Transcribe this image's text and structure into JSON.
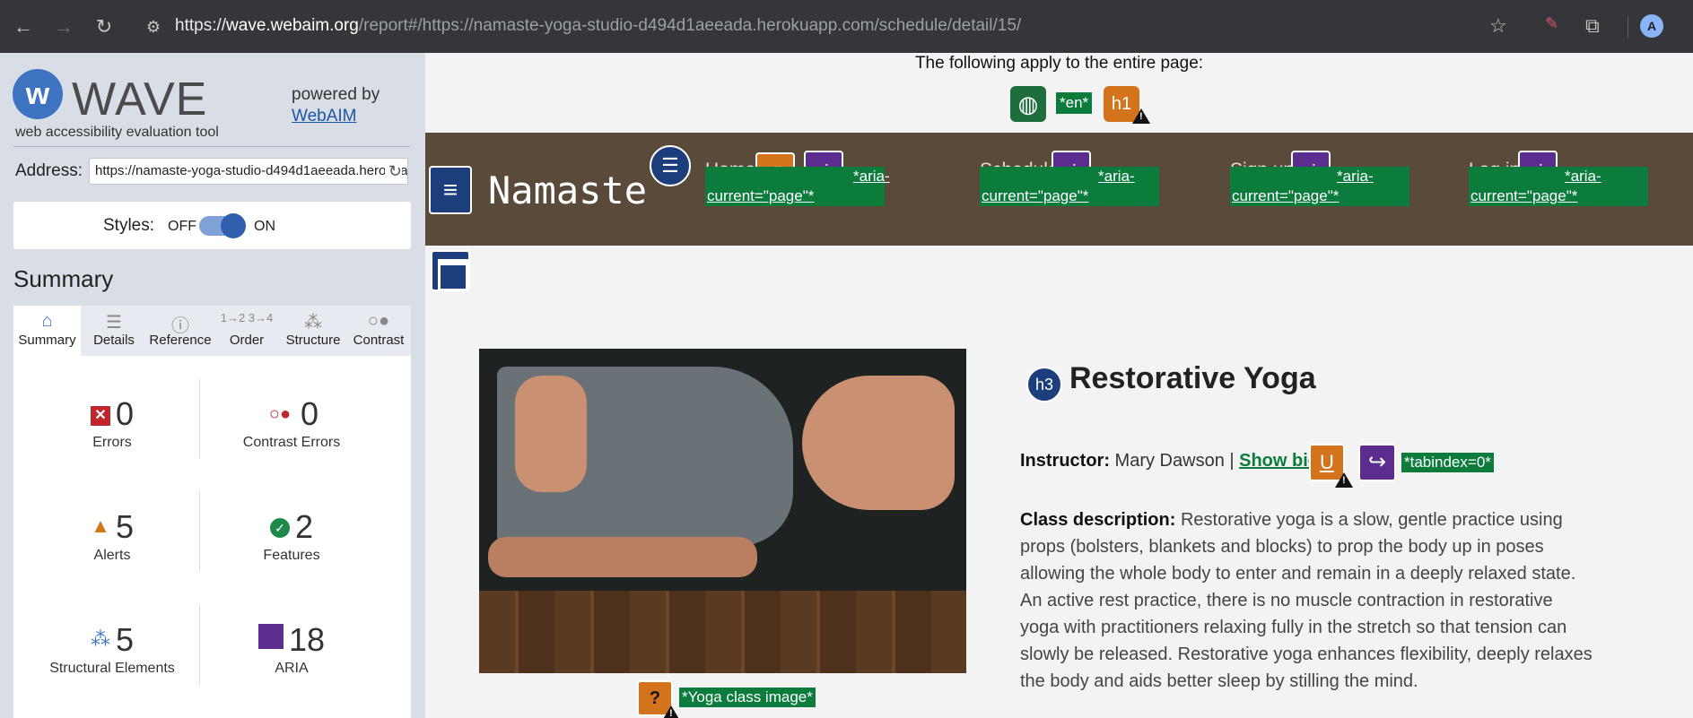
{
  "browser": {
    "url_prefix": "https://",
    "url_host": "wave.webaim.org",
    "url_path": "/report#/https://namaste-yoga-studio-d494d1aeeada.herokuapp.com/schedule/detail/15/",
    "avatar_letter": "A"
  },
  "sidebar": {
    "logo_letter": "w",
    "title": "WAVE",
    "subtitle": "web accessibility evaluation tool",
    "powered_by": "powered by",
    "powered_link": "WebAIM",
    "address_label": "Address:",
    "address_value": "https://namaste-yoga-studio-d494d1aeeada.herokuapp.com/schedule/detail/15/",
    "styles_label": "Styles:",
    "styles_off": "OFF",
    "styles_on": "ON",
    "summary_heading": "Summary",
    "tabs": [
      {
        "label": "Summary",
        "icon": "home-icon"
      },
      {
        "label": "Details",
        "icon": "list-icon"
      },
      {
        "label": "Reference",
        "icon": "info-icon"
      },
      {
        "label": "Order",
        "icon": "order-icon"
      },
      {
        "label": "Structure",
        "icon": "structure-icon"
      },
      {
        "label": "Contrast",
        "icon": "contrast-icon"
      }
    ],
    "counts": {
      "errors": {
        "value": "0",
        "label": "Errors"
      },
      "contrast": {
        "value": "0",
        "label": "Contrast Errors"
      },
      "alerts": {
        "value": "5",
        "label": "Alerts"
      },
      "features": {
        "value": "2",
        "label": "Features"
      },
      "structural": {
        "value": "5",
        "label": "Structural Elements"
      },
      "aria": {
        "value": "18",
        "label": "ARIA"
      }
    }
  },
  "page": {
    "apply_text": "The following apply to the entire page:",
    "lang_tag": "*en*",
    "h1_badge": "h1",
    "brand": "Namaste",
    "nav": [
      {
        "label": "Home",
        "tag": "*aria-current=\"page\"*"
      },
      {
        "label": "Schedule",
        "tag": "*aria-current=\"page\"*"
      },
      {
        "label": "Sign up",
        "tag": "*aria-current=\"page\"*"
      },
      {
        "label": "Log in",
        "tag": "*aria-current=\"page\"*"
      }
    ],
    "aria_badge": "aria",
    "img_alt": "*Yoga class image*",
    "h3_badge": "h3",
    "class_title": "Restorative Yoga",
    "instructor_label": "Instructor:",
    "instructor_name": " Mary Dawson | ",
    "show_bio": "Show bio",
    "tabindex_tag": "*tabindex=0*",
    "desc_label": "Class description:",
    "desc_text": " Restorative yoga is a slow, gentle practice using props (bolsters, blankets and blocks) to prop the body up in poses allowing the whole body to enter and remain in a deeply relaxed state. An active rest practice, there is no muscle contraction in restorative yoga with practitioners relaxing fully in the stretch so that tension can slowly be released. Restorative yoga enhances flexibility, deeply relaxes the body and aids better sleep by stilling the mind."
  },
  "colors": {
    "feature_green": "#0b7c3b",
    "aria_purple": "#5b2d8e",
    "alert_orange": "#d3731c",
    "structure_blue": "#1c3e7c",
    "nav_brown": "#5a4a3a"
  }
}
